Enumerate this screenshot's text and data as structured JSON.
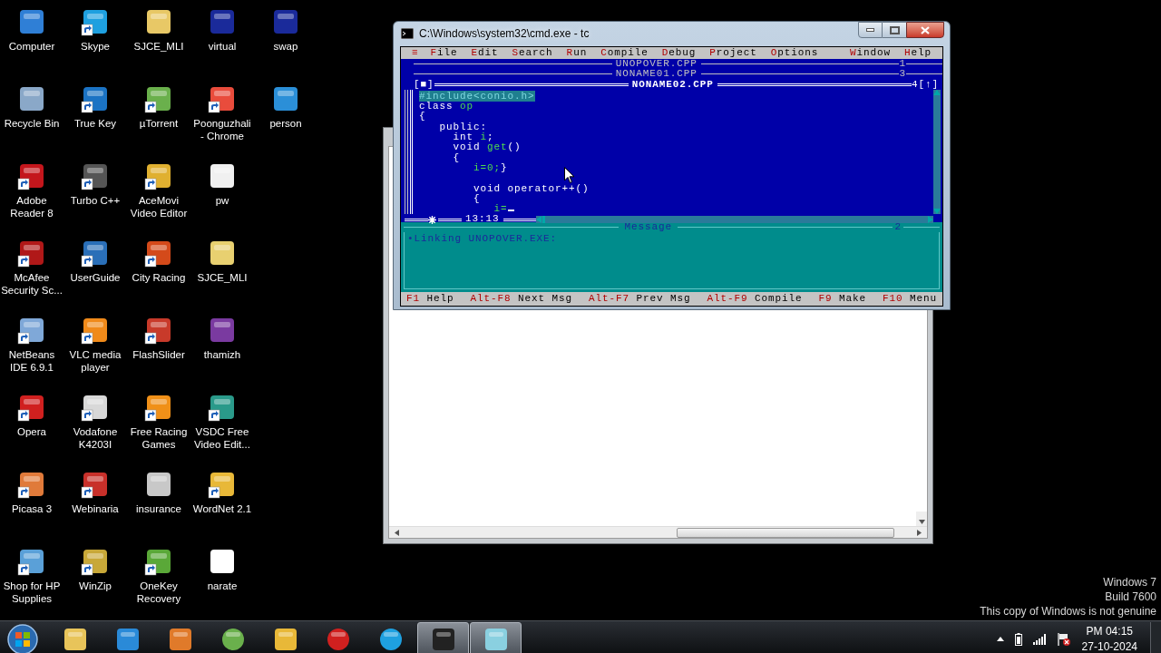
{
  "desktop_rows": [
    [
      {
        "label": "Computer",
        "shortcut": false
      },
      {
        "label": "Skype",
        "shortcut": true
      },
      {
        "label": "SJCE_MLI",
        "shortcut": false
      },
      {
        "label": "virtual",
        "shortcut": false
      },
      {
        "label": "swap",
        "shortcut": false
      }
    ],
    [
      {
        "label": "Recycle Bin",
        "shortcut": false
      },
      {
        "label": "True Key",
        "shortcut": true
      },
      {
        "label": "µTorrent",
        "shortcut": true
      },
      {
        "label": "Poonguzhali - Chrome",
        "shortcut": true
      },
      {
        "label": "person",
        "shortcut": false
      }
    ],
    [
      {
        "label": "Adobe Reader 8",
        "shortcut": true
      },
      {
        "label": "Turbo C++",
        "shortcut": true
      },
      {
        "label": "AceMovi Video Editor",
        "shortcut": true
      },
      {
        "label": "pw",
        "shortcut": false
      }
    ],
    [
      {
        "label": "McAfee Security Sc...",
        "shortcut": true
      },
      {
        "label": "UserGuide",
        "shortcut": true
      },
      {
        "label": "City Racing",
        "shortcut": true
      },
      {
        "label": "SJCE_MLI",
        "shortcut": false
      }
    ],
    [
      {
        "label": "NetBeans IDE 6.9.1",
        "shortcut": true
      },
      {
        "label": "VLC media player",
        "shortcut": true
      },
      {
        "label": "FlashSlider",
        "shortcut": true
      },
      {
        "label": "thamizh",
        "shortcut": false
      }
    ],
    [
      {
        "label": "Opera",
        "shortcut": true
      },
      {
        "label": "Vodafone K4203I",
        "shortcut": true
      },
      {
        "label": "Free Racing Games",
        "shortcut": true
      },
      {
        "label": "VSDC Free Video Edit...",
        "shortcut": true
      }
    ],
    [
      {
        "label": "Picasa 3",
        "shortcut": true
      },
      {
        "label": "Webinaria",
        "shortcut": true
      },
      {
        "label": "insurance",
        "shortcut": false
      },
      {
        "label": "WordNet 2.1",
        "shortcut": true
      }
    ],
    [
      {
        "label": "Shop for HP Supplies",
        "shortcut": true
      },
      {
        "label": "WinZip",
        "shortcut": true
      },
      {
        "label": "OneKey Recovery",
        "shortcut": true
      },
      {
        "label": "narate",
        "shortcut": false
      }
    ]
  ],
  "console": {
    "title": "C:\\Windows\\system32\\cmd.exe - tc",
    "system_menu": "≡",
    "menu_left": [
      "File",
      "Edit",
      "Search",
      "Run",
      "Compile",
      "Debug",
      "Project",
      "Options"
    ],
    "menu_right": [
      "Window",
      "Help"
    ],
    "editor_windows": [
      {
        "title": "UNOPOVER.CPP",
        "number": "1",
        "active": false
      },
      {
        "title": "NONAME01.CPP",
        "number": "3",
        "active": false
      },
      {
        "title": "NONAME02.CPP",
        "number": "4",
        "active": true
      }
    ],
    "close_box": "[■]",
    "zoom_box": "[↑]",
    "code_lines": [
      {
        "tokens": [
          {
            "text": "#include<conio.h>",
            "kind": "selected"
          }
        ]
      },
      {
        "tokens": [
          {
            "text": "class ",
            "kind": "plain"
          },
          {
            "text": "op",
            "kind": "ident"
          }
        ]
      },
      {
        "tokens": [
          {
            "text": "{",
            "kind": "plain"
          }
        ]
      },
      {
        "tokens": [
          {
            "text": "   public:",
            "kind": "plain"
          }
        ]
      },
      {
        "tokens": [
          {
            "text": "     int ",
            "kind": "plain"
          },
          {
            "text": "i",
            "kind": "ident"
          },
          {
            "text": ";",
            "kind": "plain"
          }
        ]
      },
      {
        "tokens": [
          {
            "text": "     void ",
            "kind": "plain"
          },
          {
            "text": "get",
            "kind": "ident"
          },
          {
            "text": "()",
            "kind": "plain"
          }
        ]
      },
      {
        "tokens": [
          {
            "text": "     {",
            "kind": "plain"
          }
        ]
      },
      {
        "tokens": [
          {
            "text": "        i=0;",
            "kind": "ident"
          },
          {
            "text": "}",
            "kind": "plain"
          }
        ]
      },
      {
        "gap_before": true,
        "tokens": [
          {
            "text": "        void operator++()",
            "kind": "plain"
          }
        ]
      },
      {
        "tokens": [
          {
            "text": "        {",
            "kind": "plain"
          }
        ]
      },
      {
        "cursor": true,
        "tokens": [
          {
            "text": "           i=",
            "kind": "ident"
          }
        ]
      }
    ],
    "modified": true,
    "position": "13:13",
    "message": {
      "title": "Message",
      "number": "2",
      "text": "•Linking UNOPOVER.EXE:"
    },
    "hints": [
      {
        "key": "F1",
        "label": "Help"
      },
      {
        "key": "Alt-F8",
        "label": "Next Msg"
      },
      {
        "key": "Alt-F7",
        "label": "Prev Msg"
      },
      {
        "key": "Alt-F9",
        "label": "Compile"
      },
      {
        "key": "F9",
        "label": "Make"
      },
      {
        "key": "F10",
        "label": "Menu"
      }
    ]
  },
  "watermark": [
    "Windows 7",
    "Build 7600",
    "This copy of Windows is not genuine"
  ],
  "taskbar_items": [
    {
      "active": false
    },
    {
      "active": false
    },
    {
      "active": false
    },
    {
      "active": false
    },
    {
      "active": false
    },
    {
      "active": false
    },
    {
      "active": false
    },
    {
      "active": true
    },
    {
      "active": true
    }
  ],
  "clock": {
    "time": "PM 04:15",
    "date": "27-10-2024"
  }
}
